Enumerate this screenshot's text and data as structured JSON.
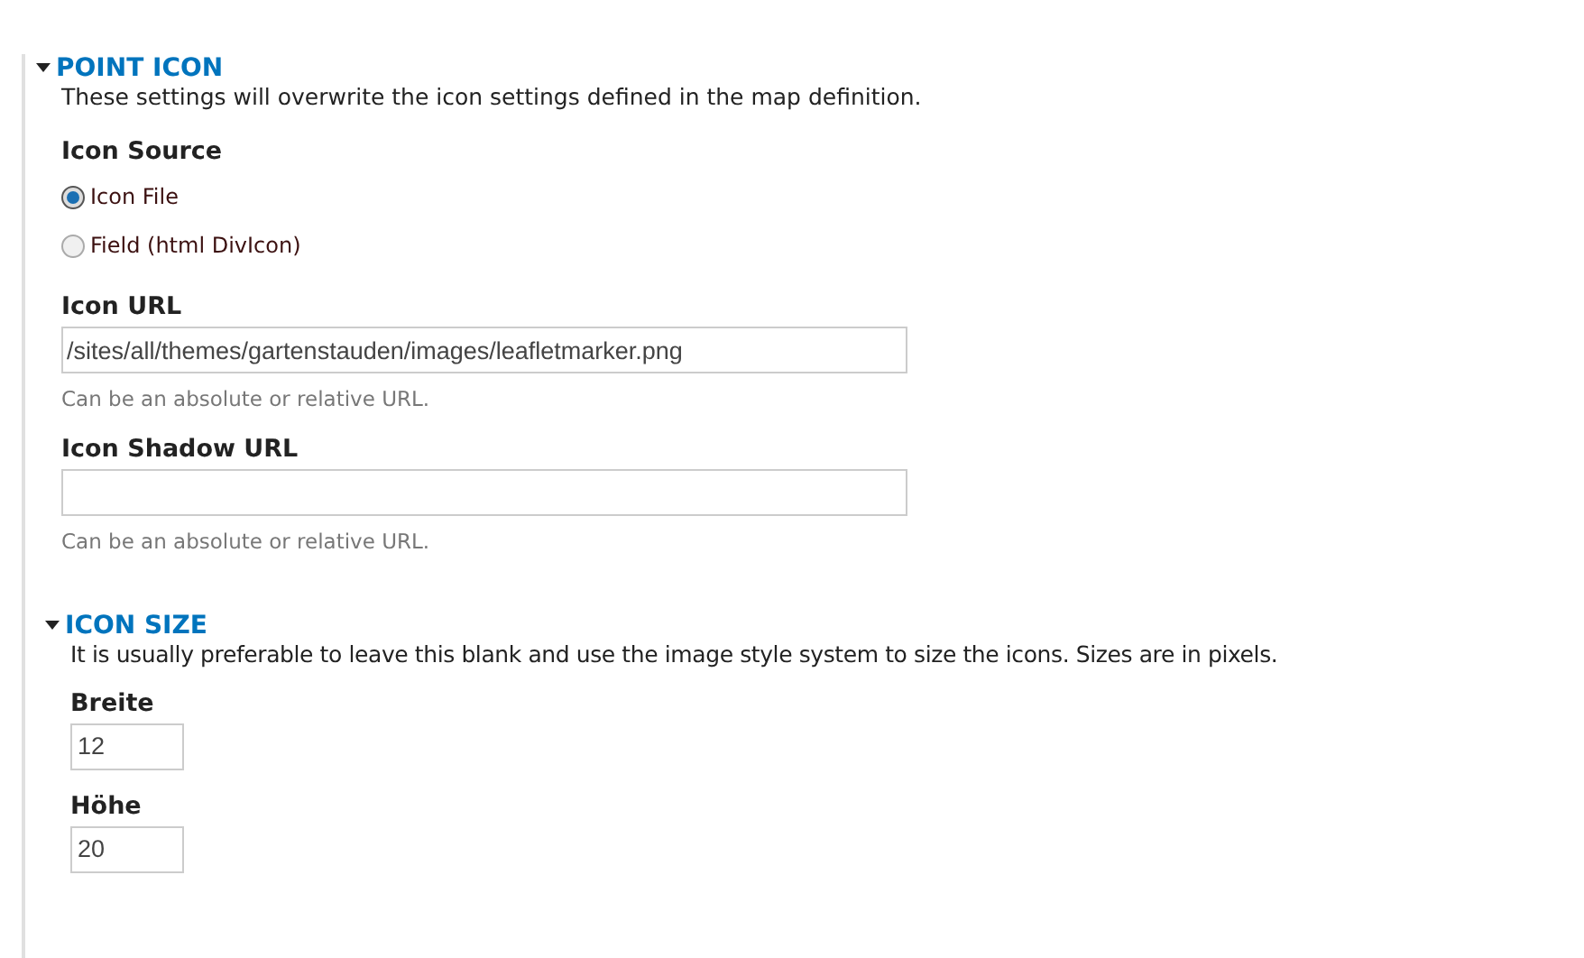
{
  "fieldset": {
    "title": "POINT ICON",
    "expanded": true,
    "description": "These settings will overwrite the icon settings defined in the map definition.",
    "icon_source": {
      "label": "Icon Source",
      "options": [
        {
          "label": "Icon File",
          "selected": true
        },
        {
          "label": "Field (html DivIcon)",
          "selected": false
        }
      ]
    },
    "fields": [
      {
        "label": "Icon URL",
        "value": "/sites/all/themes/gartenstauden/images/leafletmarker.png",
        "help": "Can be an absolute or relative URL."
      },
      {
        "label": "Icon Shadow URL",
        "help": "Can be an absolute or relative URL."
      }
    ],
    "icon_size": {
      "title": "ICON SIZE",
      "expanded": true,
      "description": "It is usually preferable to leave this blank and use the image style system to size the icons. Sizes are in pixels.",
      "fields": [
        {
          "label": "Breite",
          "value": "12"
        },
        {
          "label": "Höhe",
          "value": "20"
        }
      ]
    }
  }
}
